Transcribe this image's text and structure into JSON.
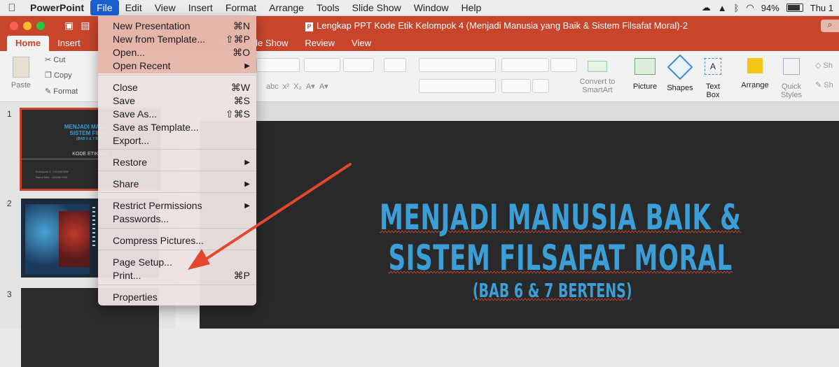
{
  "menubar": {
    "app": "PowerPoint",
    "items": [
      "File",
      "Edit",
      "View",
      "Insert",
      "Format",
      "Arrange",
      "Tools",
      "Slide Show",
      "Window",
      "Help"
    ],
    "battery": "94%",
    "battery_level": 0.94,
    "clock": "Thu 1"
  },
  "window": {
    "title": "Lengkap PPT Kode Etik Kelompok 4 (Menjadi Manusia yang Baik & Sistem Filsafat Moral)-2",
    "tabs": [
      "Home",
      "Insert",
      "ns",
      "Slide Show",
      "Review",
      "View"
    ]
  },
  "ribbon": {
    "paste": "Paste",
    "cut": "Cut",
    "copy": "Copy",
    "format": "Format",
    "convert": "Convert to",
    "smartart": "SmartArt",
    "picture": "Picture",
    "shapes": "Shapes",
    "text": "Text",
    "box": "Box",
    "arrange": "Arrange",
    "quick": "Quick",
    "styles": "Styles",
    "sh1": "Sh",
    "sh2": "Sh"
  },
  "file_menu": {
    "items": [
      {
        "label": "New Presentation",
        "shortcut": "⌘N"
      },
      {
        "label": "New from Template...",
        "shortcut": "⇧⌘P"
      },
      {
        "label": "Open...",
        "shortcut": "⌘O"
      },
      {
        "label": "Open Recent",
        "shortcut": "▶"
      },
      {
        "label": "Close",
        "shortcut": "⌘W"
      },
      {
        "label": "Save",
        "shortcut": "⌘S"
      },
      {
        "label": "Save As...",
        "shortcut": "⇧⌘S"
      },
      {
        "label": "Save as Template...",
        "shortcut": ""
      },
      {
        "label": "Export...",
        "shortcut": ""
      },
      {
        "label": "Restore",
        "shortcut": "▶"
      },
      {
        "label": "Share",
        "shortcut": "▶"
      },
      {
        "label": "Restrict Permissions",
        "shortcut": "▶"
      },
      {
        "label": "Passwords...",
        "shortcut": ""
      },
      {
        "label": "Compress Pictures...",
        "shortcut": ""
      },
      {
        "label": "Page Setup...",
        "shortcut": ""
      },
      {
        "label": "Print...",
        "shortcut": "⌘P"
      },
      {
        "label": "Properties",
        "shortcut": ""
      }
    ]
  },
  "slides_pane": {
    "numbers": [
      "1",
      "2",
      "3"
    ],
    "thumb1_title1": "MENJADI MANUSIA",
    "thumb1_title2": "SISTEM FILSAF",
    "thumb1_sub": "(BAB 6 & 7 BERT",
    "thumb1_course": "KODE ETIK KEL",
    "thumb1_line1": "Kelompok 4 · 1234567890",
    "thumb1_line2": "Nama Mhs · 1234567890"
  },
  "slide": {
    "line1": "MENJADI MANUSIA BAIK &",
    "line2": "SISTEM FILSAFAT MORAL",
    "subtitle": "(BAB 6 & 7 BERTENS)"
  },
  "colors": {
    "accent": "#c8452c",
    "title_blue": "#3b9ed6",
    "slide_bg": "#292929",
    "menu_highlight": "#1a5fd0",
    "annotation_arrow": "#e4472f"
  }
}
